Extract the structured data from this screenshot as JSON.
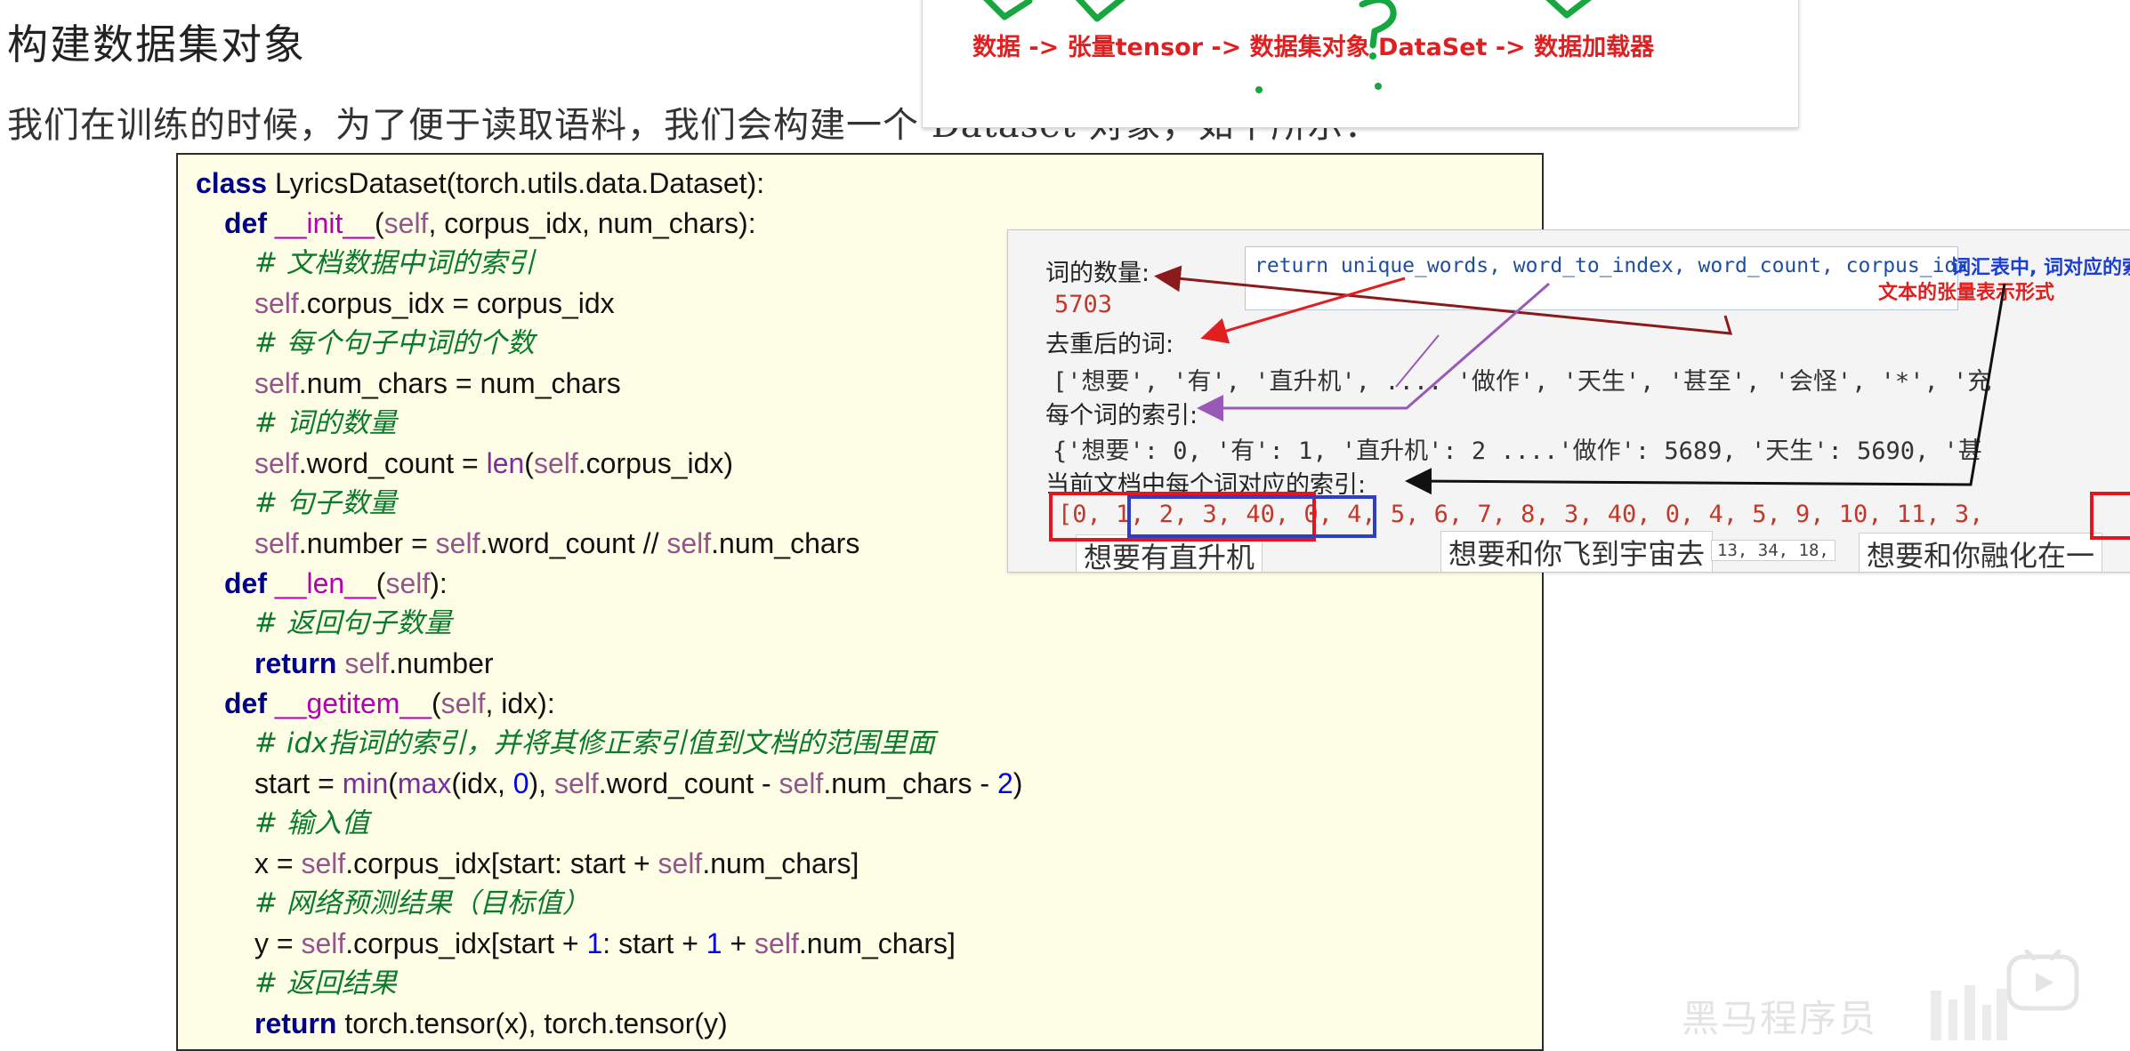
{
  "section": {
    "title": "构建数据集对象",
    "intro": "我们在训练的时候，为了便于读取语料，我们会构建一个 Dataset 对象，如下所示："
  },
  "flow_banner": {
    "text": "数据 -> 张量tensor -> 数据集对象 DataSet -> 数据加载器",
    "color": "#e02020",
    "annotation_color": "#18a640"
  },
  "code": {
    "l1": {
      "kw": "class",
      "rest": " LyricsDataset(torch.utils.data.Dataset):"
    },
    "l2": {
      "kw": "def",
      "name": "__init__",
      "p1": "(",
      "self": "self",
      "rest": ", corpus_idx, num_chars):"
    },
    "l3": "# 文档数据中词的索引",
    "l4": {
      "self": "self",
      "rest": ".corpus_idx = corpus_idx"
    },
    "l5": "# 每个句子中词的个数",
    "l6": {
      "self": "self",
      "rest": ".num_chars = num_chars"
    },
    "l7": "# 词的数量",
    "l8": {
      "self": "self",
      "a": ".word_count = ",
      "fn": "len",
      "b": "(",
      "self2": "self",
      "c": ".corpus_idx)"
    },
    "l9": "# 句子数量",
    "l10": {
      "self": "self",
      "a": ".number = ",
      "self2": "self",
      "b": ".word_count // ",
      "self3": "self",
      "c": ".num_chars"
    },
    "l11": {
      "kw": "def",
      "name": "__len__",
      "p1": "(",
      "self": "self",
      "rest": "):"
    },
    "l12": "# 返回句子数量",
    "l13": {
      "kw": "return",
      "self": "self",
      "rest": ".number"
    },
    "l14": {
      "kw": "def",
      "name": "__getitem__",
      "p1": "(",
      "self": "self",
      "rest": ", idx):"
    },
    "l15": "# idx指词的索引，并将其修正索引值到文档的范围里面",
    "l16": {
      "a": "start = ",
      "fn1": "min",
      "b": "(",
      "fn2": "max",
      "c": "(idx, ",
      "n0": "0",
      "d": "), ",
      "self": "self",
      "e": ".word_count - ",
      "self2": "self",
      "f": ".num_chars - ",
      "n2": "2",
      "g": ")"
    },
    "l17": "# 输入值",
    "l18": {
      "a": "x = ",
      "self": "self",
      "b": ".corpus_idx[start: start + ",
      "self2": "self",
      "c": ".num_chars]"
    },
    "l19": "# 网络预测结果（目标值）",
    "l20": {
      "a": "y = ",
      "self": "self",
      "b": ".corpus_idx[start + ",
      "n1": "1",
      "c": ": start + ",
      "n1b": "1",
      "d": " + ",
      "self2": "self",
      "e": ".num_chars]"
    },
    "l21": "# 返回结果",
    "l22": {
      "kw": "return",
      "rest": " torch.tensor(x), torch.tensor(y)"
    }
  },
  "inset": {
    "return_line": "return unique_words, word_to_index, word_count, corpus_idx",
    "vocab_note": "词汇表中, 词对应的索",
    "tensor_note": "文本的张量表示形式",
    "word_count_label": "词的数量:",
    "word_count_value": "5703",
    "unique_label": "去重后的词:",
    "unique_values": "['想要', '有', '直升机', .... '做作', '天生', '甚至', '会怪', '*', '充",
    "index_label": "每个词的索引:",
    "index_values": "{'想要': 0, '有': 1, '直升机': 2 ....'做作': 5689, '天生': 5690, '甚",
    "corpus_label": "当前文档中每个词对应的索引:",
    "corpus_values": "[0, 1, 2, 3, 40, 0, 4, 5, 6, 7, 8, 3, 40, 0, 4, 5, 9, 10, 11, 3,",
    "lyric1": "想要有直升机",
    "lyric2": "想要和你飞到宇宙去",
    "idx_fragment": "13, 34, 18,",
    "lyric3": "想要和你融化在一"
  },
  "watermark": {
    "text": "黑马程序员"
  }
}
